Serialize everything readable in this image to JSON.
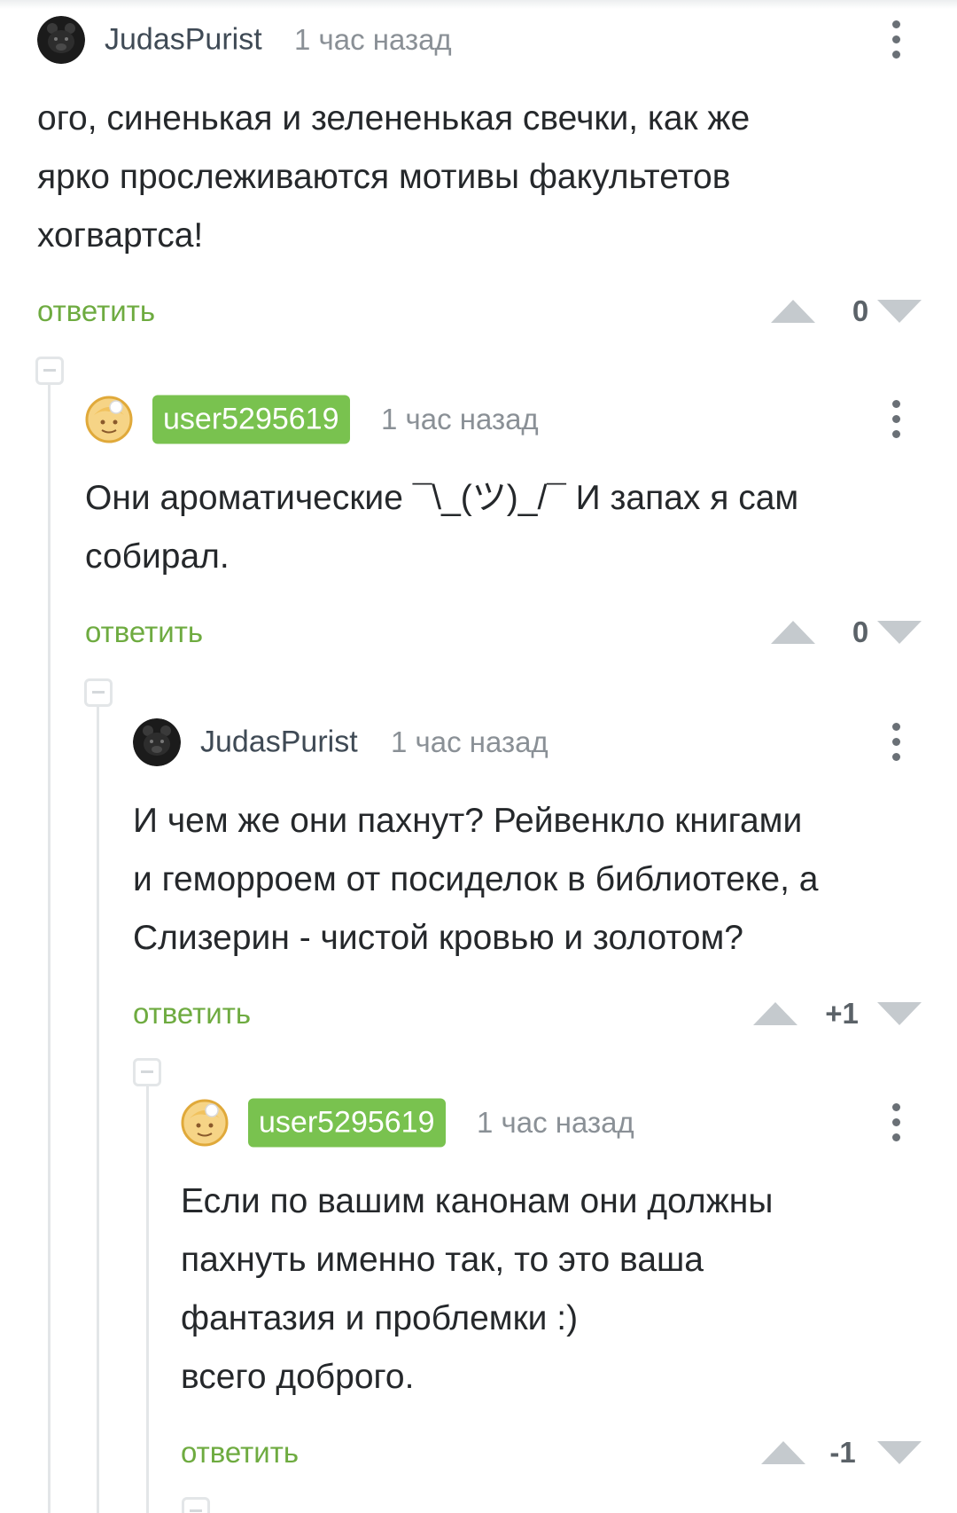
{
  "comments": [
    {
      "author": "JudasPurist",
      "avatar_icon": "bear-avatar-icon",
      "time": "1 час назад",
      "text": "ого, синенькая и зелененькая свечки, как же\nярко прослеживаются мотивы факультетов\nхогвартса!",
      "reply_label": "ответить",
      "score": "0"
    },
    {
      "author": "user5295619",
      "avatar_icon": "cartoon-face-avatar-icon",
      "time": "1 час назад",
      "text": "Они ароматические ¯\\_(ツ)_/¯ И запах я сам\nсобирал.",
      "reply_label": "ответить",
      "score": "0"
    },
    {
      "author": "JudasPurist",
      "avatar_icon": "bear-avatar-icon",
      "time": "1 час назад",
      "text": "И чем же они пахнут? Рейвенкло книгами\nи геморроем от посиделок в библиотеке, а\nСлизерин - чистой кровью и золотом?",
      "reply_label": "ответить",
      "score": "+1"
    },
    {
      "author": "user5295619",
      "avatar_icon": "cartoon-face-avatar-icon",
      "time": "1 час назад",
      "text": "Если по вашим канонам они должны\nпахнуть именно так, то это ваша\nфантазия и проблемки :)\nвсего доброго.",
      "reply_label": "ответить",
      "score": "-1"
    }
  ],
  "colors": {
    "accent_green": "#79c24f",
    "reply_green": "#6eab40",
    "vote_arrow": "#c5cace",
    "thread_line": "#e3e6e8"
  }
}
